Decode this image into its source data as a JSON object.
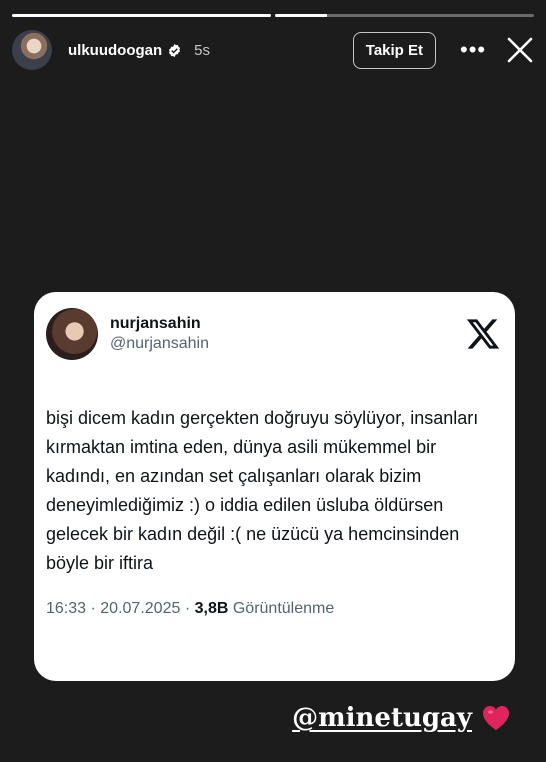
{
  "story": {
    "progress": [
      1,
      0.2
    ],
    "user": {
      "username": "ulkuudoogan",
      "verified": true,
      "time_ago": "5s"
    },
    "follow_label": "Takip Et",
    "more_icon": "more-horizontal-icon",
    "close_icon": "close-icon"
  },
  "tweet": {
    "display_name": "nurjansahin",
    "handle": "@nurjansahin",
    "logo": "x-logo-icon",
    "text": "bişi dicem kadın gerçekten doğruyu söylüyor, insanları kırmaktan imtina eden, dünya asili mükemmel bir kadındı, en azından set çalışanları olarak bizim deneyimlediğimiz :) o iddia edilen üsluba öldürsen gelecek bir kadın değil :( ne üzücü ya hemcinsinden böyle bir iftira",
    "time": "16:33",
    "date": "20.07.2025",
    "views_count": "3,8B",
    "views_label": "Görüntülenme"
  },
  "mention": {
    "text": "@minetugay",
    "emoji": "heart-icon"
  },
  "colors": {
    "background": "#1c1c1c",
    "card": "#ffffff",
    "heart": "#e0245e"
  }
}
